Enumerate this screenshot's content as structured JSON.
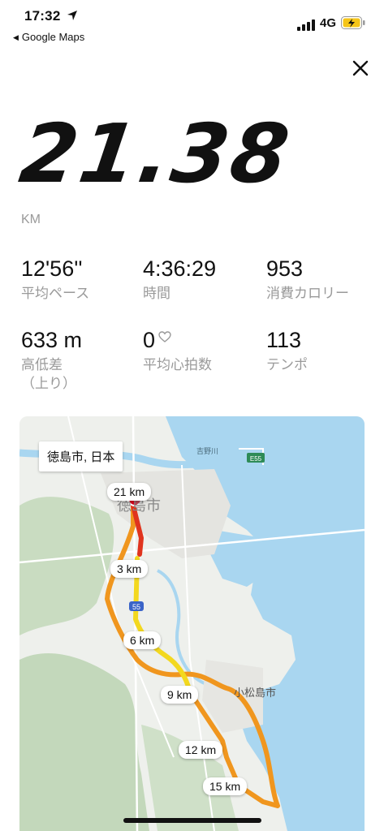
{
  "status_bar": {
    "time": "17:32",
    "back_app": "Google Maps",
    "network": "4G"
  },
  "summary": {
    "distance": "21.38",
    "unit": "KM"
  },
  "stats": [
    {
      "value": "12'56''",
      "label": "平均ペース"
    },
    {
      "value": "4:36:29",
      "label": "時間"
    },
    {
      "value": "953",
      "label": "消費カロリー"
    },
    {
      "value": "633 m",
      "label": "高低差\n（上り）"
    },
    {
      "value": "0",
      "label": "平均心拍数",
      "icon": "heart-outline-icon"
    },
    {
      "value": "113",
      "label": "テンポ"
    }
  ],
  "map": {
    "city": "徳島市, 日本",
    "markers": [
      "21 km",
      "3 km",
      "6 km",
      "9 km",
      "12 km",
      "15 km"
    ],
    "labels": {
      "tokushima": "徳島市",
      "komatsushima": "小松島市",
      "river": "吉野川",
      "highway": "E55",
      "route": "55"
    },
    "colors": {
      "water": "#a9d6f0",
      "land": "#eef0ec",
      "route_orange": "#f0961e",
      "route_yellow": "#f3d81f",
      "route_red": "#e0341e",
      "start_marker": "#d6001c"
    }
  }
}
